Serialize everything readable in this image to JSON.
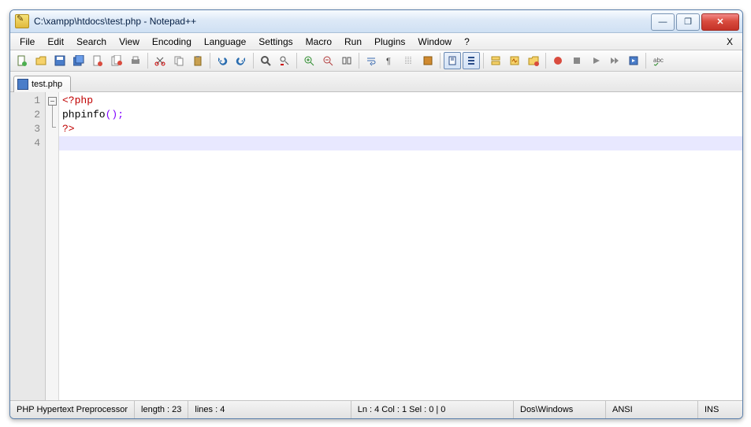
{
  "window": {
    "title": "C:\\xampp\\htdocs\\test.php - Notepad++"
  },
  "menu": {
    "items": [
      "File",
      "Edit",
      "Search",
      "View",
      "Encoding",
      "Language",
      "Settings",
      "Macro",
      "Run",
      "Plugins",
      "Window",
      "?"
    ],
    "right": "X"
  },
  "tabs": [
    {
      "label": "test.php"
    }
  ],
  "code": {
    "lines": [
      {
        "n": "1",
        "type": "tag",
        "text": "<?php"
      },
      {
        "n": "2",
        "type": "call",
        "func": "phpinfo",
        "call": "();"
      },
      {
        "n": "3",
        "type": "tag",
        "text": "?>"
      },
      {
        "n": "4",
        "type": "blank",
        "text": ""
      }
    ],
    "current_line": 4
  },
  "status": {
    "lang": "PHP Hypertext Preprocessor",
    "length": "length : 23",
    "lines": "lines : 4",
    "pos": "Ln : 4    Col : 1    Sel : 0 | 0",
    "eol": "Dos\\Windows",
    "enc": "ANSI",
    "mode": "INS"
  },
  "icons": {
    "min": "—",
    "max": "❐",
    "close": "✕"
  }
}
